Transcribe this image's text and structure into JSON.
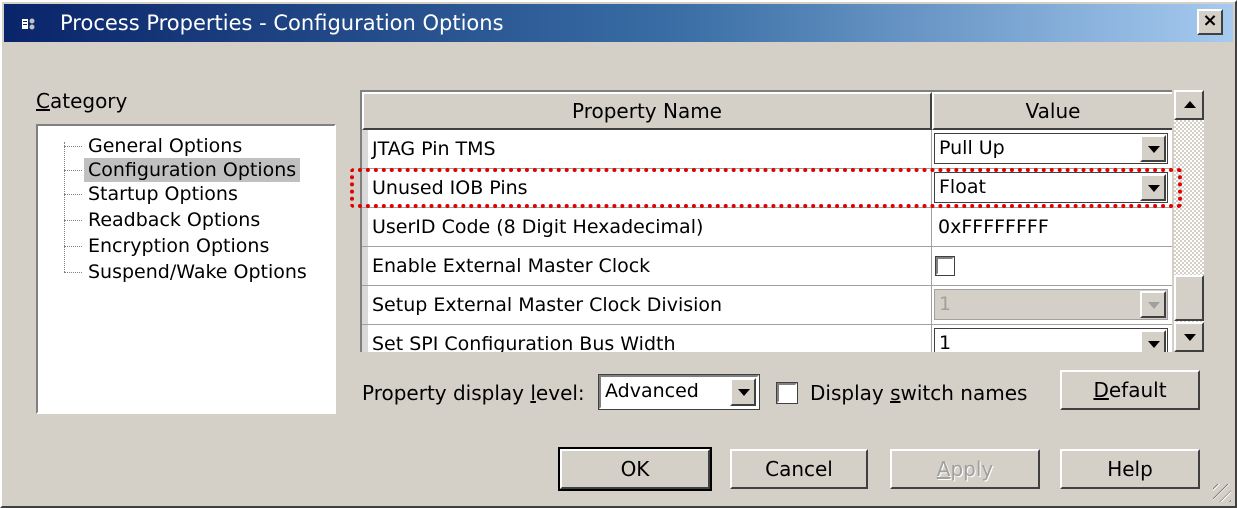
{
  "window": {
    "title": "Process Properties - Configuration Options",
    "close_glyph": "×"
  },
  "category": {
    "label_accel": "C",
    "label_rest": "ategory",
    "items": [
      {
        "label": "General Options",
        "selected": false
      },
      {
        "label": "Configuration Options",
        "selected": true
      },
      {
        "label": "Startup Options",
        "selected": false
      },
      {
        "label": "Readback Options",
        "selected": false
      },
      {
        "label": "Encryption Options",
        "selected": false
      },
      {
        "label": "Suspend/Wake Options",
        "selected": false
      }
    ]
  },
  "grid": {
    "col_name": "Property Name",
    "col_value": "Value",
    "rows": [
      {
        "name": "JTAG Pin TMS",
        "value": "Pull Up",
        "control": "combo"
      },
      {
        "name": "Unused IOB Pins",
        "value": "Float",
        "control": "combo",
        "highlighted": true
      },
      {
        "name": "UserID Code (8 Digit Hexadecimal)",
        "value": "0xFFFFFFFF",
        "control": "text"
      },
      {
        "name": "Enable External Master Clock",
        "value": "",
        "control": "checkbox",
        "checked": false
      },
      {
        "name": "Setup External Master Clock Division",
        "value": "1",
        "control": "combo-disabled"
      },
      {
        "name": "Set SPI Configuration Bus Width",
        "value": "1",
        "control": "combo"
      }
    ],
    "highlight_color": "#e00000"
  },
  "footer": {
    "level_label_pre": "Property display ",
    "level_label_accel": "l",
    "level_label_post": "evel:",
    "level_value": "Advanced",
    "switch_label_pre": "Display ",
    "switch_label_accel": "s",
    "switch_label_post": "witch names",
    "switch_checked": false,
    "default_accel": "D",
    "default_rest": "efault"
  },
  "buttons": {
    "ok": "OK",
    "cancel": "Cancel",
    "apply_accel": "A",
    "apply_rest": "pply",
    "help": "Help"
  },
  "colors": {
    "title_start": "#0a246a",
    "title_end": "#a6caf0",
    "face": "#d4d0c8"
  }
}
